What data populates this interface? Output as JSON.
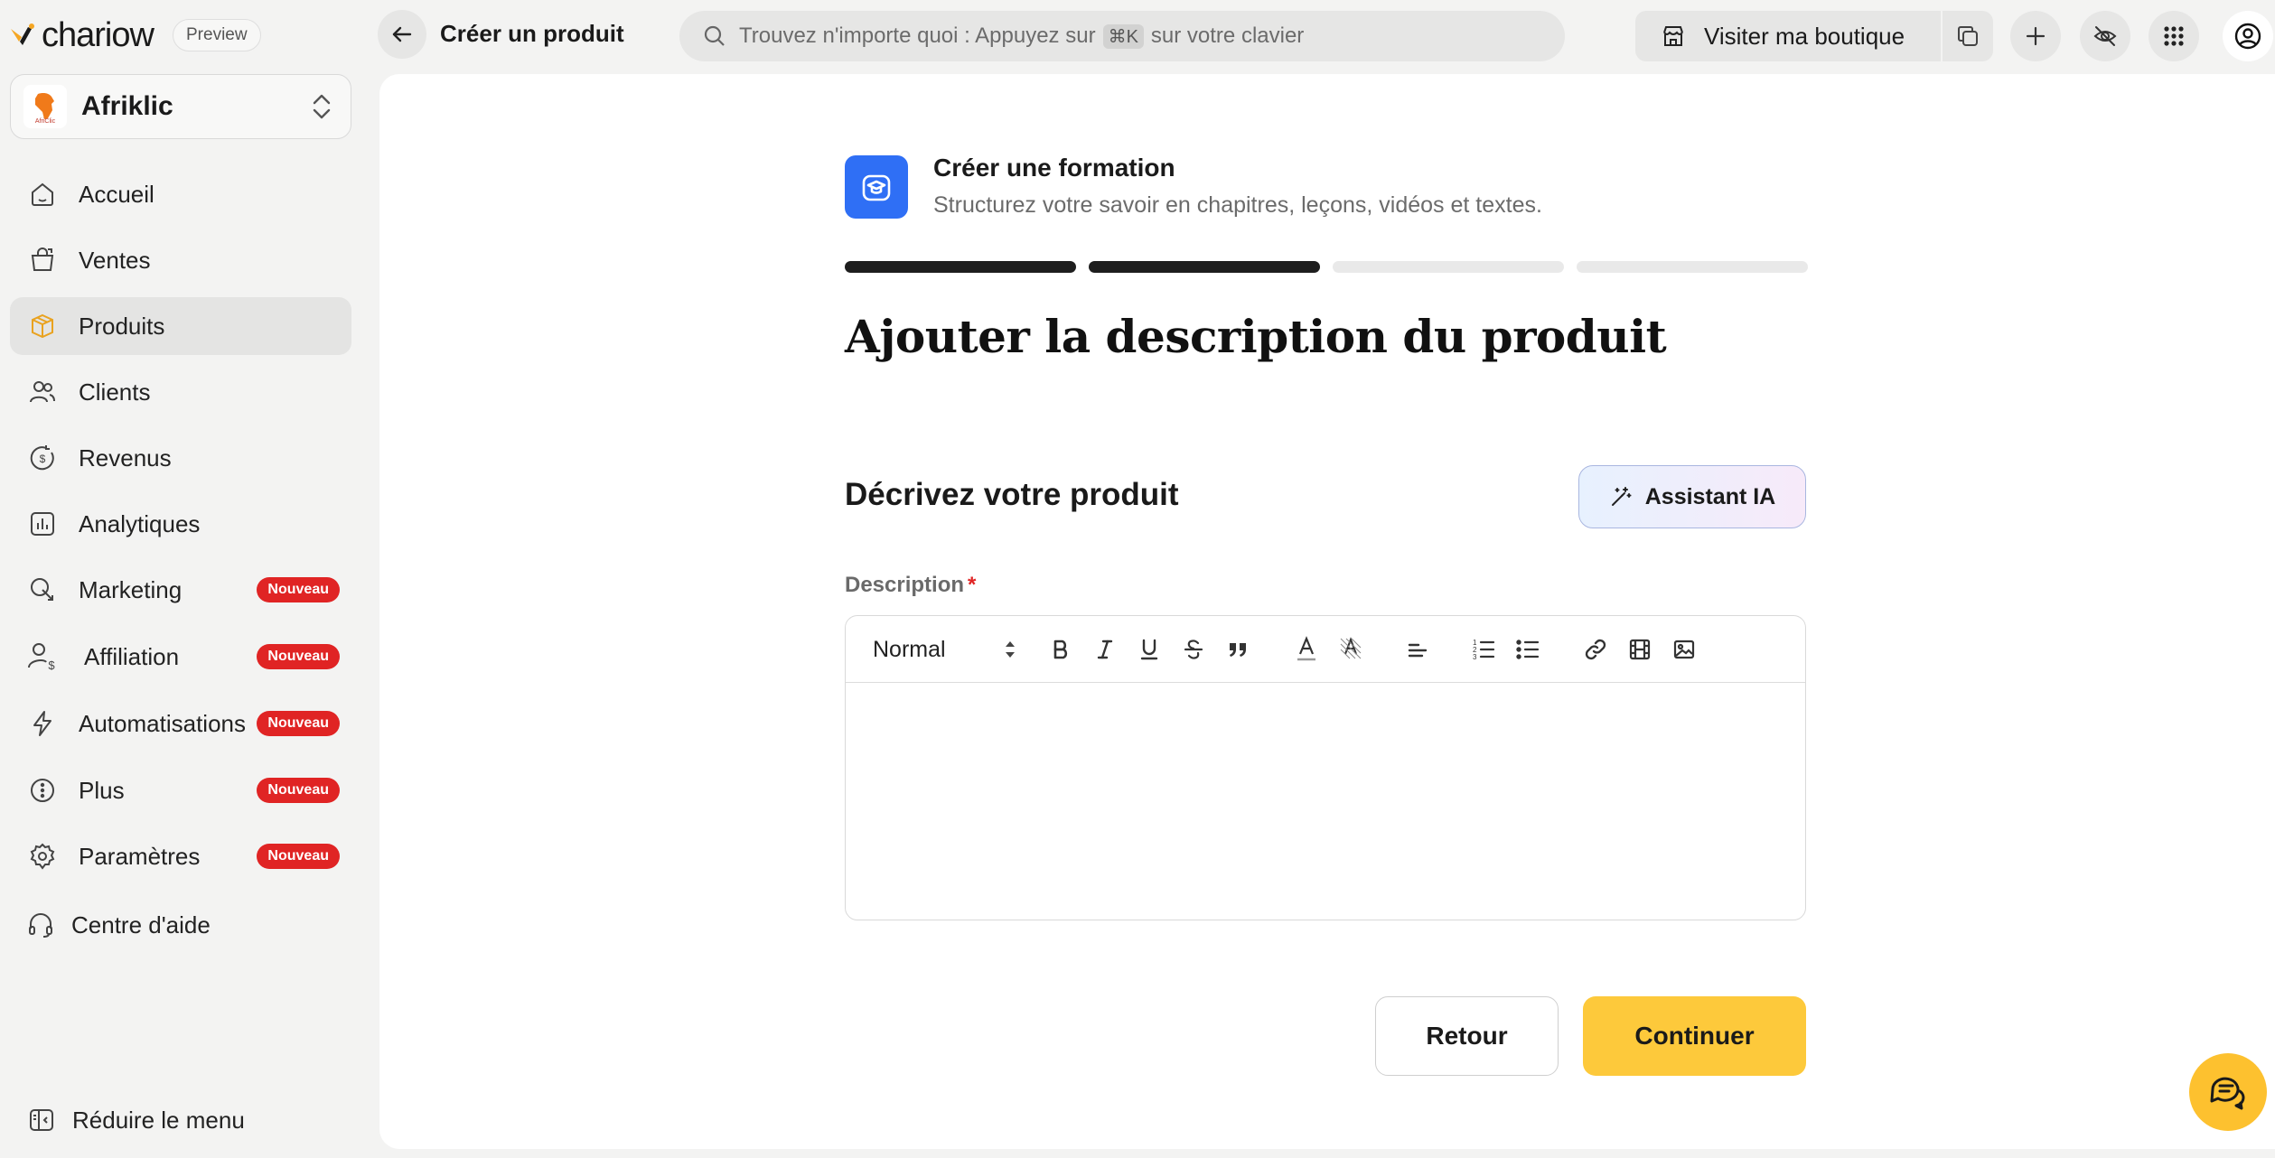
{
  "brand": {
    "name": "chariow",
    "preview_label": "Preview"
  },
  "store": {
    "name": "Afriklic",
    "logo_text": "AfriClic"
  },
  "sidebar": {
    "items": [
      {
        "id": "accueil",
        "label": "Accueil",
        "icon": "home-icon"
      },
      {
        "id": "ventes",
        "label": "Ventes",
        "icon": "shopping-bag-icon"
      },
      {
        "id": "produits",
        "label": "Produits",
        "icon": "box-icon",
        "active": true
      },
      {
        "id": "clients",
        "label": "Clients",
        "icon": "users-icon"
      },
      {
        "id": "revenus",
        "label": "Revenus",
        "icon": "dollar-refresh-icon"
      },
      {
        "id": "analytiques",
        "label": "Analytiques",
        "icon": "bar-chart-icon"
      },
      {
        "id": "marketing",
        "label": "Marketing",
        "icon": "megaphone-icon",
        "badge": "Nouveau"
      },
      {
        "id": "affiliation",
        "label": "Affiliation",
        "icon": "user-dollar-icon",
        "badge": "Nouveau"
      },
      {
        "id": "automatisations",
        "label": "Automatisations",
        "icon": "lightning-icon",
        "badge": "Nouveau"
      },
      {
        "id": "plus",
        "label": "Plus",
        "icon": "more-icon",
        "badge": "Nouveau"
      },
      {
        "id": "parametres",
        "label": "Paramètres",
        "icon": "gear-icon",
        "badge": "Nouveau"
      },
      {
        "id": "aide",
        "label": "Centre d'aide",
        "icon": "headset-icon"
      }
    ],
    "reduce_label": "Réduire le menu"
  },
  "topbar": {
    "title": "Créer un produit",
    "search_before": "Trouvez n'importe quoi : Appuyez sur",
    "search_kbd": "⌘K",
    "search_after": "sur votre clavier",
    "visit_shop": "Visiter ma boutique"
  },
  "form": {
    "type_title": "Créer une formation",
    "type_subtitle": "Structurez votre savoir en chapitres, leçons, vidéos et textes.",
    "steps": {
      "total": 4,
      "completed": 2
    },
    "heading": "Ajouter la description du produit",
    "section_title": "Décrivez votre produit",
    "ai_button": "Assistant IA",
    "description_label": "Description",
    "required_mark": "*",
    "editor": {
      "format": "Normal",
      "value": ""
    },
    "back_button": "Retour",
    "continue_button": "Continuer"
  },
  "colors": {
    "accent": "#fdc93b",
    "primary_icon": "#2f6ff5",
    "badge": "#e02424",
    "active_nav": "#e4e4e3"
  }
}
